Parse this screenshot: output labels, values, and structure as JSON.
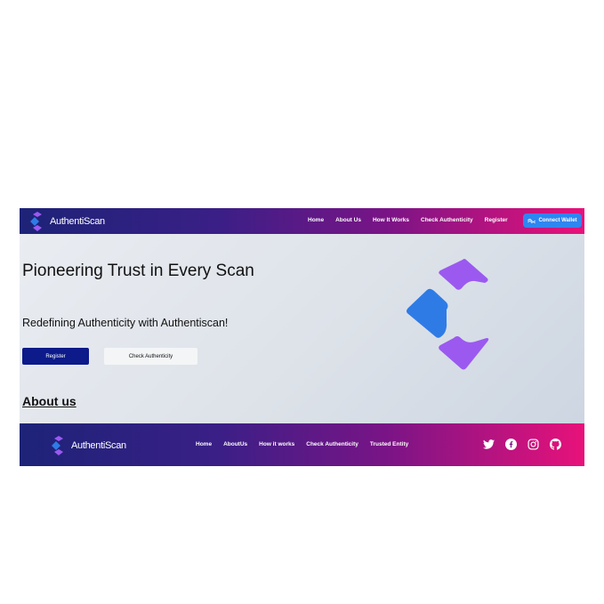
{
  "brand": {
    "name": "AuthentiScan"
  },
  "header": {
    "nav": [
      "Home",
      "About Us",
      "How It Works",
      "Check Authenticity",
      "Register"
    ],
    "connect_wallet": "Connect Wallet"
  },
  "hero": {
    "title": "Pioneering Trust in Every Scan",
    "subtitle": "Redefining Authenticity with Authentiscan!",
    "register_button": "Register",
    "check_button": "Check Authenticity"
  },
  "about": {
    "heading": "About us"
  },
  "footer": {
    "nav": [
      "Home",
      "AboutUs",
      "How it works",
      "Check Authenticity",
      "Trusted Entity"
    ],
    "social_icons": [
      "twitter-icon",
      "facebook-icon",
      "instagram-icon",
      "github-icon"
    ]
  },
  "colors": {
    "gradient_start": "#1d2378",
    "gradient_end": "#e8127a",
    "logo_blue": "#2f7be6",
    "logo_purple": "#9b59f0",
    "button_blue": "#2f86f1",
    "register_navy": "#0c1a8a"
  }
}
